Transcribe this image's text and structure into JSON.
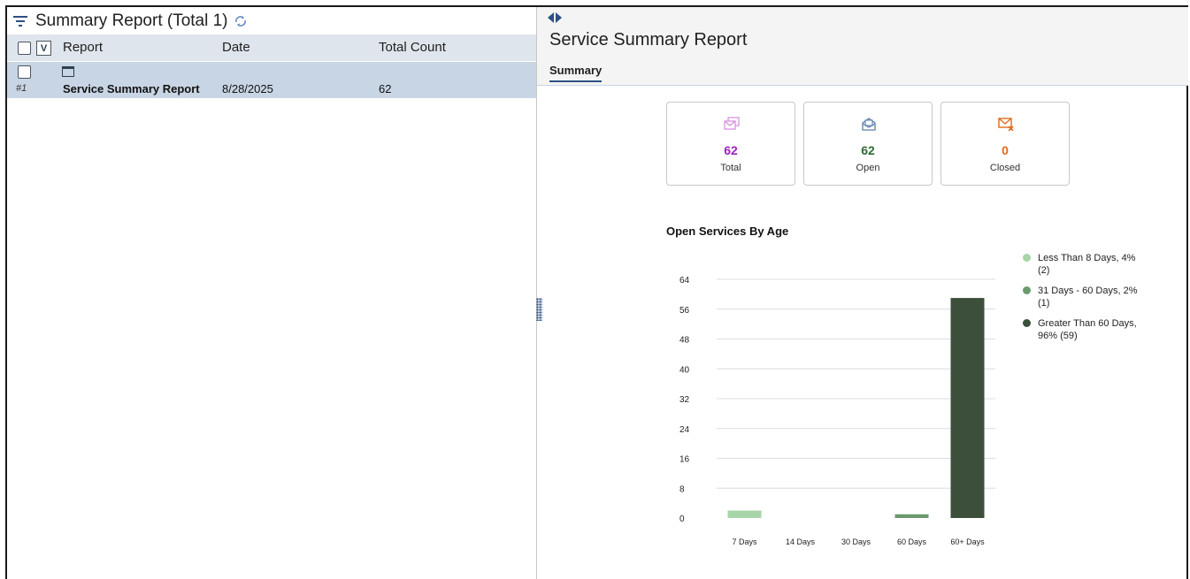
{
  "left_panel": {
    "title": "Summary Report (Total 1)",
    "columns": {
      "report": "Report",
      "date": "Date",
      "total_count": "Total Count"
    },
    "rows": [
      {
        "num": "#1",
        "report": "Service Summary Report",
        "date": "8/28/2025",
        "total_count": "62"
      }
    ],
    "select_toggle": "V"
  },
  "right_panel": {
    "title": "Service Summary Report",
    "tab": "Summary",
    "cards": [
      {
        "value": "62",
        "label": "Total",
        "color": "#a020c0",
        "icon": "stacked-mail-icon"
      },
      {
        "value": "62",
        "label": "Open",
        "color": "#2e6b34",
        "icon": "open-mail-icon"
      },
      {
        "value": "0",
        "label": "Closed",
        "color": "#e06a1a",
        "icon": "closed-mail-icon"
      }
    ]
  },
  "chart_data": {
    "type": "bar",
    "title": "Open Services By Age",
    "categories": [
      "7 Days",
      "14 Days",
      "30 Days",
      "60 Days",
      "60+ Days"
    ],
    "values": [
      2,
      0,
      0,
      1,
      59
    ],
    "bar_colors": [
      "#a8d5a8",
      "#a8d5a8",
      "#7fa97f",
      "#6b9a6e",
      "#3c4f3a"
    ],
    "yticks": [
      0,
      8,
      16,
      24,
      32,
      40,
      48,
      56,
      64
    ],
    "ylim": [
      0,
      64
    ],
    "legend": [
      {
        "label": "Less Than 8 Days, 4% (2)",
        "color": "#a8d5a8"
      },
      {
        "label": "31 Days - 60 Days, 2% (1)",
        "color": "#6b9a6e"
      },
      {
        "label": "Greater Than 60 Days, 96% (59)",
        "color": "#3c4f3a"
      }
    ],
    "legend_position": "right"
  }
}
